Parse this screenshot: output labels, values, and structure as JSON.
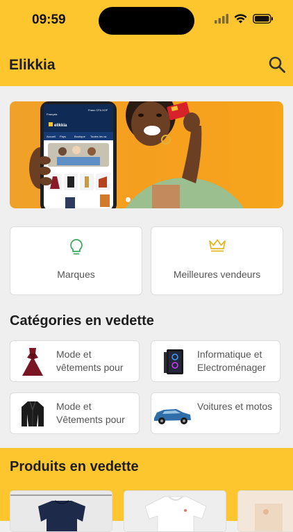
{
  "status": {
    "time": "09:59"
  },
  "app": {
    "title": "Elikkia"
  },
  "banner": {
    "logo": "elikkia",
    "phone_tabs": [
      "Accueil",
      "Pays",
      "Boutique",
      "Toutes les ca"
    ],
    "phone_top_right": "Franc CFA XOF",
    "slide_count": 1
  },
  "quick": [
    {
      "label": "Marques",
      "icon": "lightbulb-icon"
    },
    {
      "label": "Meilleures vendeurs",
      "icon": "crown-icon"
    }
  ],
  "categories_title": "Catégories en vedette",
  "categories": [
    {
      "label": "Mode et vêtements pour",
      "icon": "dress-image"
    },
    {
      "label": "Informatique et Electroménager",
      "icon": "computer-tower-image"
    },
    {
      "label": "Mode et Vêtements pour",
      "icon": "leather-jacket-image"
    },
    {
      "label": "Voitures et motos",
      "icon": "car-image"
    }
  ],
  "featured_title": "Produits en vedette",
  "colors": {
    "accent": "#fdc52e",
    "background": "#efefef"
  }
}
